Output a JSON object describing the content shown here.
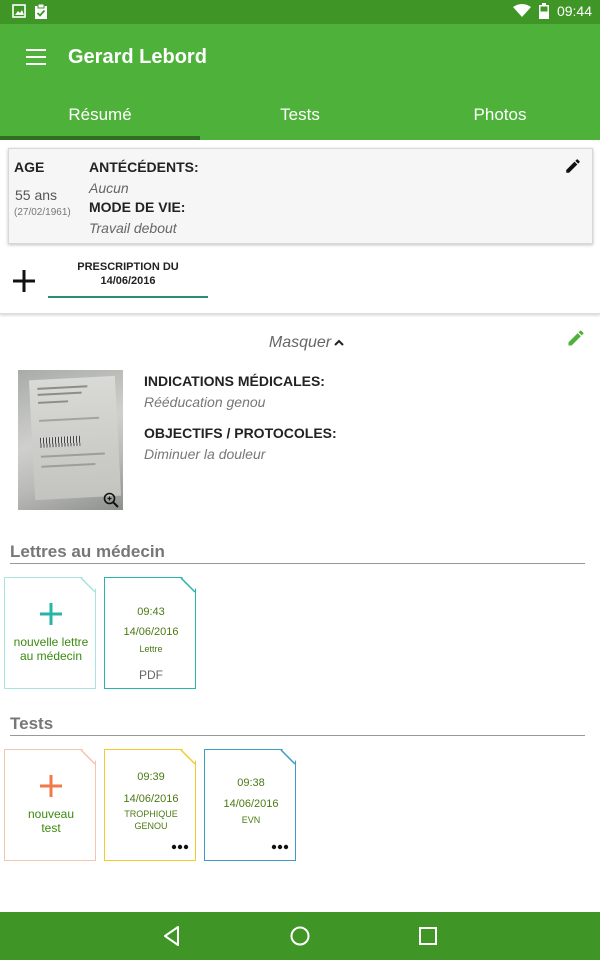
{
  "status_bar": {
    "time": "09:44"
  },
  "app_bar": {
    "title": "Gerard Lebord"
  },
  "tabs": [
    {
      "label": "Résumé",
      "active": true
    },
    {
      "label": "Tests",
      "active": false
    },
    {
      "label": "Photos",
      "active": false
    }
  ],
  "patient": {
    "age_label": "AGE",
    "age_value": "55 ans",
    "birth_date": "(27/02/1961)",
    "antecedents_label": "ANTÉCÉDENTS:",
    "antecedents_value": "Aucun",
    "lifestyle_label": "MODE DE VIE:",
    "lifestyle_value": "Travail debout"
  },
  "prescription": {
    "tab_label_line1": "PRESCRIPTION DU",
    "tab_label_line2": "14/06/2016"
  },
  "details": {
    "toggle_label": "Masquer",
    "indications_label": "INDICATIONS MÉDICALES:",
    "indications_value": "Rééducation genou",
    "objectives_label": "OBJECTIFS / PROTOCOLES:",
    "objectives_value": "Diminuer la douleur"
  },
  "letters": {
    "section_title": "Lettres au médecin",
    "new_label_line1": "nouvelle lettre",
    "new_label_line2": "au médecin",
    "items": [
      {
        "time": "09:43",
        "date": "14/06/2016",
        "name": "Lettre",
        "format": "PDF"
      }
    ]
  },
  "tests": {
    "section_title": "Tests",
    "new_label_line1": "nouveau",
    "new_label_line2": "test",
    "items": [
      {
        "time": "09:39",
        "date": "14/06/2016",
        "name_line1": "TROPHIQUE",
        "name_line2": "GENOU"
      },
      {
        "time": "09:38",
        "date": "14/06/2016",
        "name_line1": "EVN",
        "name_line2": ""
      }
    ]
  },
  "colors": {
    "app_bar": "#4eb13a",
    "status_bar": "#3f9626",
    "tab_indicator": "#2e6e22",
    "teal_accent": "#26b5a8",
    "orange_accent": "#f07a4a",
    "yellow_accent": "#f2cc2e",
    "blue_accent": "#3a9dc8",
    "edit_green": "#4eb13a"
  }
}
